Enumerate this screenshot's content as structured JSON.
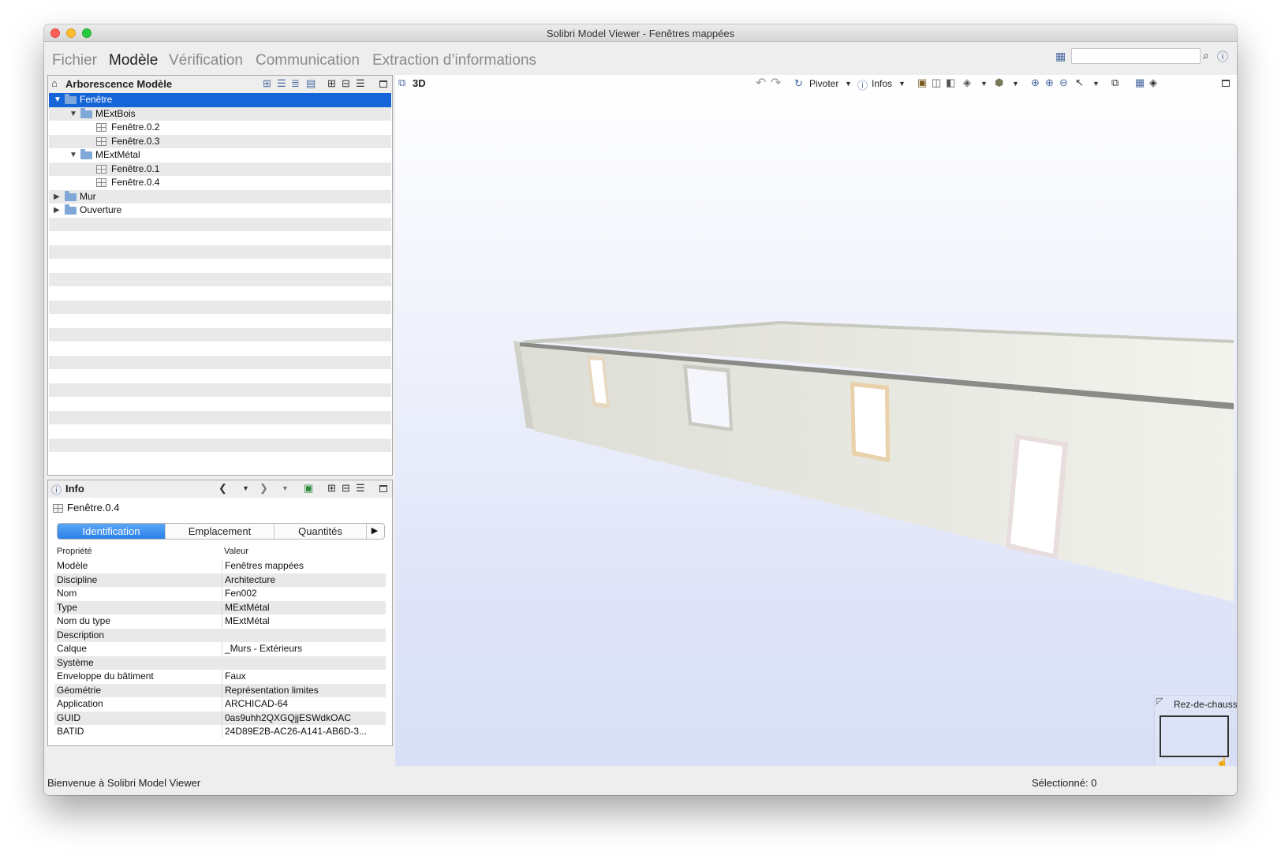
{
  "window": {
    "title": "Solibri Model Viewer - Fenêtres mappées"
  },
  "menu": {
    "items": [
      "Fichier",
      "Modèle",
      "Vérification",
      "Communication",
      "Extraction d’informations"
    ],
    "active": "Modèle"
  },
  "search": {
    "placeholder": ""
  },
  "tree_panel": {
    "title": "Arborescence Modèle",
    "rows": [
      {
        "label": "Fenêtre",
        "level": 0,
        "type": "folder",
        "expanded": true,
        "selected": true
      },
      {
        "label": "MExtBois",
        "level": 1,
        "type": "folder",
        "expanded": true
      },
      {
        "label": "Fenêtre.0.2",
        "level": 2,
        "type": "item"
      },
      {
        "label": "Fenêtre.0.3",
        "level": 2,
        "type": "item"
      },
      {
        "label": "MExtMétal",
        "level": 1,
        "type": "folder",
        "expanded": true
      },
      {
        "label": "Fenêtre.0.1",
        "level": 2,
        "type": "item"
      },
      {
        "label": "Fenêtre.0.4",
        "level": 2,
        "type": "item"
      },
      {
        "label": "Mur",
        "level": 0,
        "type": "folder",
        "expanded": false
      },
      {
        "label": "Ouverture",
        "level": 0,
        "type": "folder",
        "expanded": false
      }
    ]
  },
  "info_panel": {
    "title": "Info",
    "selected_item": "Fenêtre.0.4",
    "tabs": [
      "Identification",
      "Emplacement",
      "Quantités"
    ],
    "active_tab": "Identification",
    "columns": [
      "Propriété",
      "Valeur"
    ],
    "properties": [
      [
        "Modèle",
        "Fenêtres mappées"
      ],
      [
        "Discipline",
        "Architecture"
      ],
      [
        "Nom",
        "Fen002"
      ],
      [
        "Type",
        "MExtMétal"
      ],
      [
        "Nom du type",
        "MExtMétal"
      ],
      [
        "Description",
        ""
      ],
      [
        "Calque",
        "_Murs - Extérieurs"
      ],
      [
        "Système",
        ""
      ],
      [
        "Enveloppe du bâtiment",
        "Faux"
      ],
      [
        "Géométrie",
        "Représentation limites"
      ],
      [
        "Application",
        "ARCHICAD-64"
      ],
      [
        "GUID",
        "0as9uhh2QXGQjjESWdkOAC"
      ],
      [
        "BATID",
        "24D89E2B-AC26-A141-AB6D-3..."
      ]
    ]
  },
  "viewport": {
    "title": "3D",
    "rotate_label": "Pivoter",
    "infos_label": "Infos",
    "minimap_label": "Rez-de-chaussée"
  },
  "status": {
    "message": "Bienvenue à Solibri Model Viewer",
    "selected": "Sélectionné: 0"
  },
  "colors": {
    "selection": "#1665d8",
    "tab_active": "#2a80ea",
    "folder": "#7fa8d9"
  }
}
